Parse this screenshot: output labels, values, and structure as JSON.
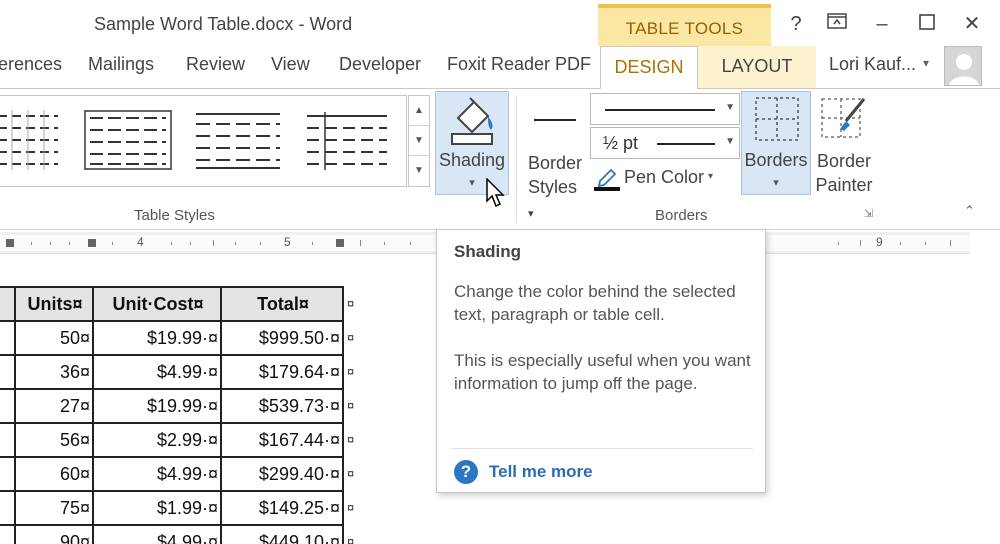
{
  "window": {
    "title": "Sample Word Table.docx - Word",
    "contextual_group": "TABLE TOOLS",
    "controls": {
      "help": "?",
      "ribbon_display": "⊡",
      "minimize": "–",
      "maximize": "☐",
      "close": "✕"
    }
  },
  "tabs": {
    "items": [
      "erences",
      "Mailings",
      "Review",
      "View",
      "Developer",
      "Foxit Reader PDF"
    ],
    "design": "DESIGN",
    "layout": "LAYOUT",
    "user_name": "Lori Kauf...",
    "user_caret": "▾"
  },
  "ribbon": {
    "table_styles_label": "Table Styles",
    "shading": {
      "label": "Shading",
      "caret": "▾",
      "fill_color": "#d8e6f5"
    },
    "border_styles": {
      "line1": "Border",
      "line2": "Styles",
      "caret": "▾"
    },
    "pen_weight": "½ pt",
    "pen_color": {
      "label": "Pen Color",
      "caret": "▾"
    },
    "borders": {
      "label": "Borders",
      "caret": "▾"
    },
    "border_painter": {
      "line1": "Border",
      "line2": "Painter"
    },
    "borders_group_label": "Borders",
    "launcher": "⇲",
    "collapse": "⌃"
  },
  "ruler": {
    "marks": [
      "4",
      "5",
      "9"
    ]
  },
  "table": {
    "headers": [
      "Units¤",
      "Unit·Cost¤",
      "Total¤"
    ],
    "rows": [
      [
        "50¤",
        "$19.99·¤",
        "$999.50·¤"
      ],
      [
        "36¤",
        "$4.99·¤",
        "$179.64·¤"
      ],
      [
        "27¤",
        "$19.99·¤",
        "$539.73·¤"
      ],
      [
        "56¤",
        "$2.99·¤",
        "$167.44·¤"
      ],
      [
        "60¤",
        "$4.99·¤",
        "$299.40·¤"
      ],
      [
        "75¤",
        "$1.99·¤",
        "$149.25·¤"
      ],
      [
        "90¤",
        "$4.99·¤",
        "$449.10·¤"
      ]
    ],
    "row_end_mark": "¤"
  },
  "tooltip": {
    "title": "Shading",
    "body1": "Change the color behind the selected text, paragraph or table cell.",
    "body2": "This is especially useful when you want information to jump off the page.",
    "help_icon": "?",
    "link": "Tell me more"
  },
  "colors": {
    "accent_tab_text": "#b07000",
    "contextual_bg": "#fbe7a4",
    "pressed_button_bg": "#d8e6f5",
    "link": "#2b6db3"
  }
}
